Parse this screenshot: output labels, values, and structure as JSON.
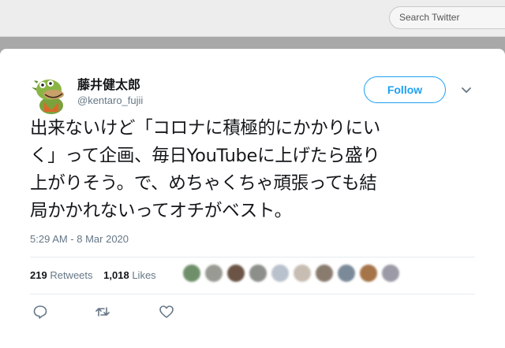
{
  "search": {
    "placeholder": "Search Twitter"
  },
  "tweet": {
    "author_name": "藤井健太郎",
    "author_handle": "@kentaro_fujii",
    "follow_label": "Follow",
    "text_lines": [
      "出来ないけど「コロナに積極的にかかりにい",
      "く」って企画、毎日YouTubeに上げたら盛り",
      "上がりそう。で、めちゃくちゃ頑張っても結",
      "局かかれないってオチがベスト。"
    ],
    "timestamp": "5:29 AM - 8 Mar 2020",
    "retweets_count": "219",
    "retweets_label": "Retweets",
    "likes_count": "1,018",
    "likes_label": "Likes"
  },
  "colors": {
    "accent": "#1da1f2",
    "text": "#14171a",
    "muted": "#657786"
  },
  "icons": [
    "avatar-image",
    "chevron-down-icon",
    "reply-icon",
    "retweet-icon",
    "like-icon"
  ]
}
